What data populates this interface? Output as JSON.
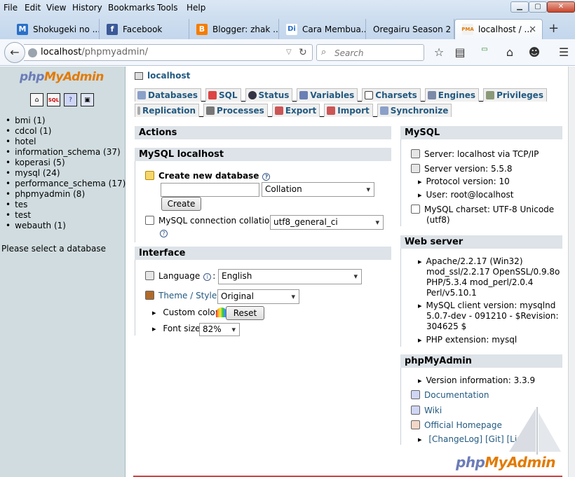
{
  "menubar": {
    "items": [
      {
        "label": "File"
      },
      {
        "label": "Edit"
      },
      {
        "label": "View"
      },
      {
        "label": "History"
      },
      {
        "label": "Bookmarks"
      },
      {
        "label": "Tools"
      },
      {
        "label": "Help"
      }
    ]
  },
  "tabs": [
    {
      "title": "Shokugeki no ...",
      "icon": "M"
    },
    {
      "title": "Facebook",
      "icon": "f"
    },
    {
      "title": "Blogger: zhak ...",
      "icon": "B"
    },
    {
      "title": "Cara Membua...",
      "icon": "Di"
    },
    {
      "title": "Oregairu Season 2 ...",
      "icon": ""
    },
    {
      "title": "localhost / ...",
      "icon": "PMA"
    }
  ],
  "address": {
    "host": "localhost",
    "path": "/phpmyadmin/"
  },
  "search": {
    "placeholder": "Search"
  },
  "colors": {
    "accent": "#235a81",
    "logo_php": "#6c7cb8",
    "logo_myadmin": "#e27a00"
  },
  "sidebar": {
    "logo": {
      "php": "php",
      "my": "My",
      "admin": "Admin"
    },
    "databases": [
      "bmi (1)",
      "cdcol (1)",
      "hotel",
      "information_schema (37)",
      "koperasi (5)",
      "mysql (24)",
      "performance_schema (17)",
      "phpmyadmin (8)",
      "tes",
      "test",
      "webauth (1)"
    ],
    "select_message": "Please select a database"
  },
  "main": {
    "server": "localhost",
    "tabs_row1": [
      "Databases",
      "SQL",
      "Status",
      "Variables",
      "Charsets",
      "Engines",
      "Privileges"
    ],
    "tabs_row2": [
      "Replication",
      "Processes",
      "Export",
      "Import",
      "Synchronize"
    ],
    "actions": {
      "title": "Actions",
      "mysql_local_title": "MySQL localhost",
      "create_db_label": "Create new database",
      "collation_placeholder": "Collation",
      "create_button": "Create",
      "conn_collation_label": "MySQL connection collation:",
      "conn_collation_value": "utf8_general_ci"
    },
    "interface": {
      "title": "Interface",
      "language_label": "Language",
      "language_value": "English",
      "theme_label": "Theme / Style",
      "theme_value": "Original",
      "custom_color_label": "Custom color:",
      "reset_button": "Reset",
      "font_size_label": "Font size:",
      "font_size_value": "82%"
    },
    "mysql": {
      "title": "MySQL",
      "server": "Server: localhost via TCP/IP",
      "version": "Server version: 5.5.8",
      "protocol": "Protocol version: 10",
      "user": "User: root@localhost",
      "charset_line1": "MySQL charset: UTF-8 Unicode",
      "charset_line2": "(utf8)"
    },
    "webserver": {
      "title": "Web server",
      "apache": [
        "Apache/2.2.17 (Win32)",
        "mod_ssl/2.2.17 OpenSSL/0.9.8o",
        "PHP/5.3.4 mod_perl/2.0.4",
        "Perl/v5.10.1"
      ],
      "client": [
        "MySQL client version: mysqlnd",
        "5.0.7-dev - 091210 - $Revision:",
        "304625 $"
      ],
      "php_ext": "PHP extension: mysql"
    },
    "pma": {
      "title": "phpMyAdmin",
      "version": "Version information: 3.3.9",
      "documentation": "Documentation",
      "wiki": "Wiki",
      "homepage": "Official Homepage",
      "changelog": "[ChangeLog]",
      "git": "[Git]",
      "lists": "[Lists]"
    },
    "watermark": {
      "php": "php",
      "myadmin": "MyAdmin"
    }
  }
}
